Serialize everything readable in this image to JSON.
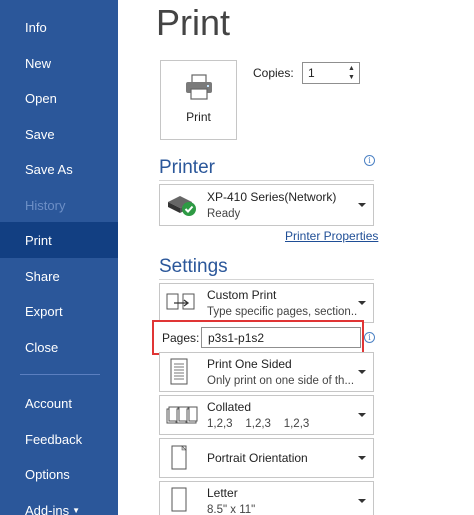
{
  "sidebar": {
    "items": [
      {
        "label": "Info"
      },
      {
        "label": "New"
      },
      {
        "label": "Open"
      },
      {
        "label": "Save"
      },
      {
        "label": "Save As"
      },
      {
        "label": "History"
      },
      {
        "label": "Print"
      },
      {
        "label": "Share"
      },
      {
        "label": "Export"
      },
      {
        "label": "Close"
      },
      {
        "label": "Account"
      },
      {
        "label": "Feedback"
      },
      {
        "label": "Options"
      },
      {
        "label": "Add-ins"
      }
    ]
  },
  "main": {
    "title": "Print",
    "print_button_label": "Print",
    "copies_label": "Copies:",
    "copies_value": "1",
    "printer_heading": "Printer",
    "printer": {
      "name": "XP-410 Series(Network)",
      "status": "Ready",
      "properties_link": "Printer Properties"
    },
    "settings_heading": "Settings",
    "settings": {
      "print_range": {
        "title": "Custom Print",
        "subtitle": "Type specific pages, section..."
      },
      "pages_label": "Pages:",
      "pages_value": "p3s1-p1s2",
      "sides": {
        "title": "Print One Sided",
        "subtitle": "Only print on one side of th..."
      },
      "collation": {
        "title": "Collated",
        "subtitle": "1,2,3    1,2,3    1,2,3"
      },
      "orientation": {
        "title": "Portrait Orientation"
      },
      "paper": {
        "title": "Letter",
        "subtitle": "8.5\" x 11\""
      }
    }
  },
  "colors": {
    "sidebar_bg": "#2b579a",
    "sidebar_active": "#123f82",
    "accent": "#2b579a",
    "highlight_border": "#e03535"
  }
}
